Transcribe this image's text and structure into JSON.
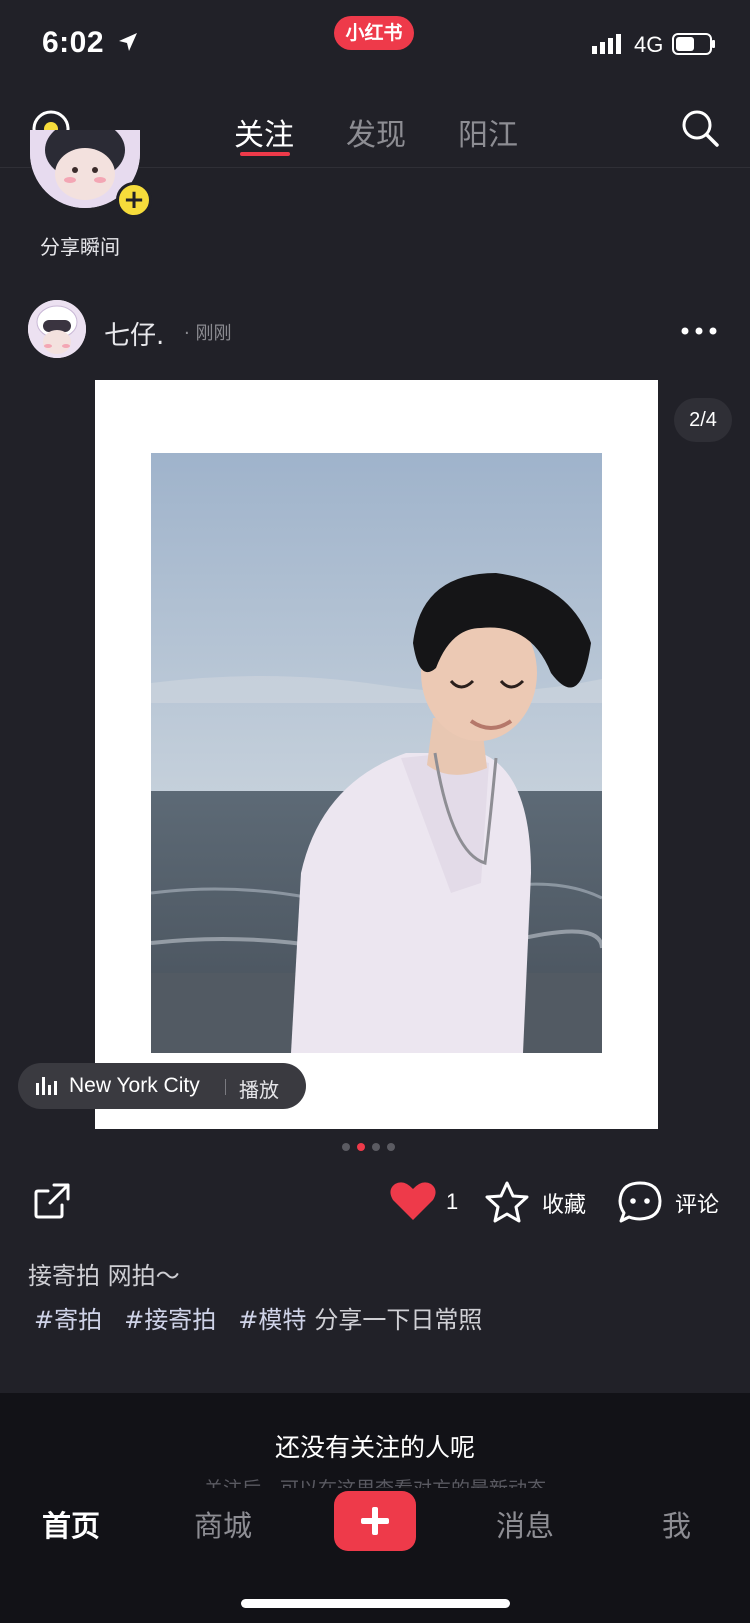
{
  "status_bar": {
    "time": "6:02",
    "network": "4G"
  },
  "app_badge": "小红书",
  "top_nav": {
    "tabs": [
      {
        "label": "关注",
        "active": true
      },
      {
        "label": "发现",
        "active": false
      },
      {
        "label": "阳江",
        "active": false
      }
    ],
    "icons": [
      "story-camera-icon",
      "search-icon"
    ]
  },
  "stories": {
    "label": "分享瞬间"
  },
  "post": {
    "author": "七仔.",
    "time": "· 刚刚",
    "page_counter": "2/4",
    "page_current": 2,
    "page_total": 4,
    "music": {
      "title": "New York City",
      "action": "播放"
    },
    "likes": "1",
    "collect_label": "收藏",
    "comment_label": "评论",
    "caption": "接寄拍 网拍～",
    "tags": [
      "#寄拍",
      "#接寄拍",
      "#模特"
    ],
    "tags_suffix": "分享一下日常照"
  },
  "empty_state": {
    "title": "还没有关注的人呢",
    "desc": "关注后，可以在这里查看对方的最新动态"
  },
  "bottom_nav": {
    "home": "首页",
    "shop": "商城",
    "messages": "消息",
    "me": "我"
  },
  "colors": {
    "accent": "#ee3a4a",
    "background": "#212128",
    "bottom_bar": "#121217"
  }
}
